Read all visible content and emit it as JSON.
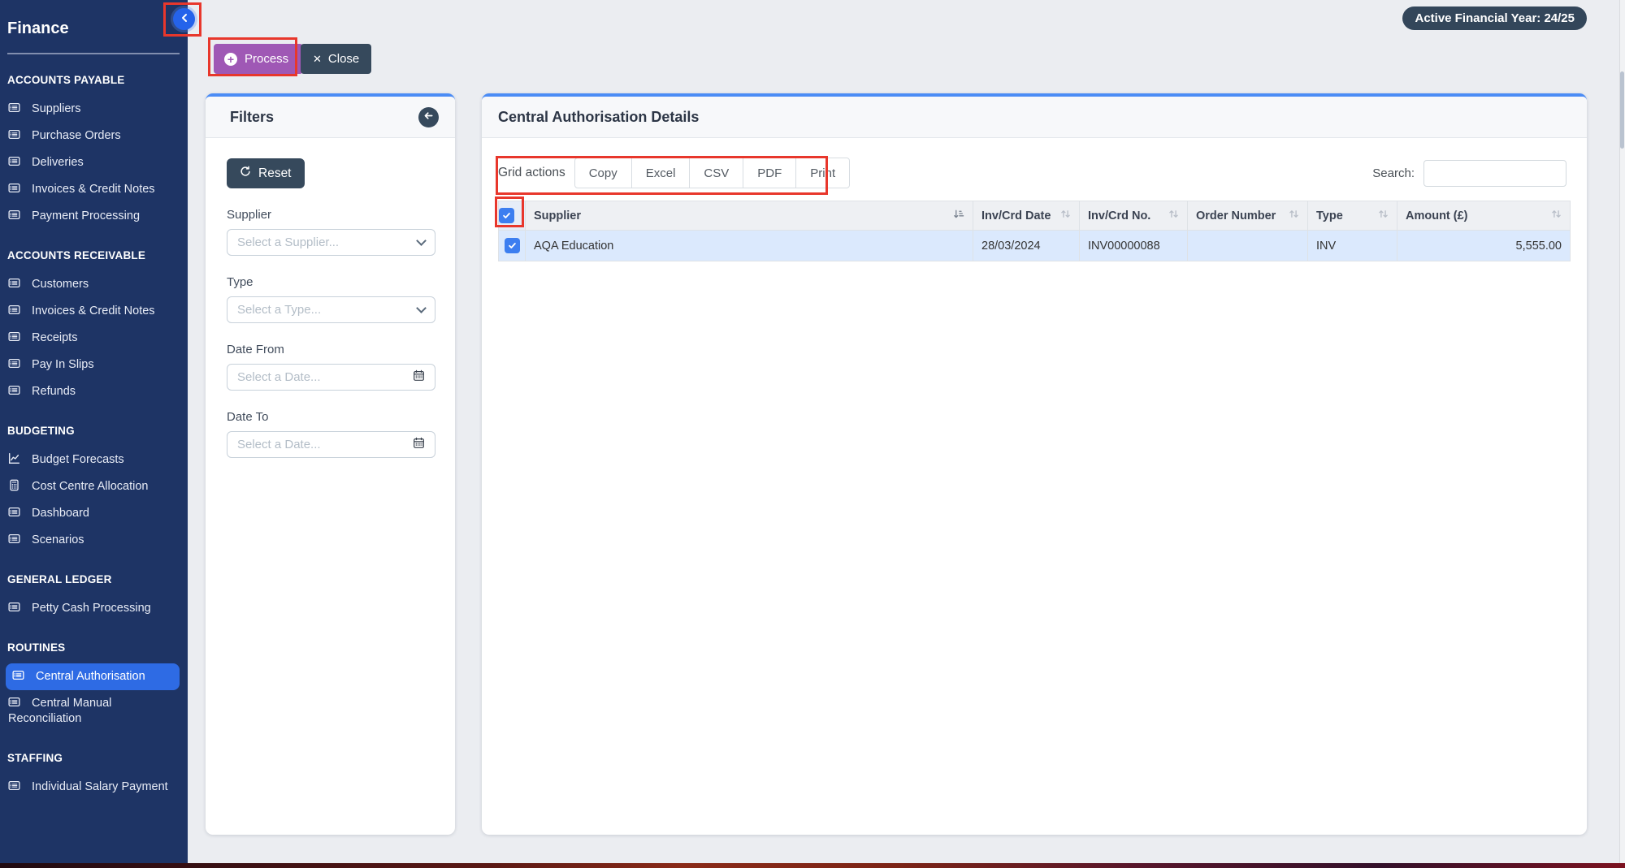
{
  "app": {
    "title": "Finance",
    "financial_year_badge": "Active Financial Year: 24/25"
  },
  "actions": {
    "process_label": "Process",
    "close_label": "Close"
  },
  "sidebar": {
    "sections": [
      {
        "title": "ACCOUNTS PAYABLE",
        "items": [
          {
            "label": "Suppliers",
            "icon": "card-list-icon"
          },
          {
            "label": "Purchase Orders",
            "icon": "card-list-icon"
          },
          {
            "label": "Deliveries",
            "icon": "card-list-icon"
          },
          {
            "label": "Invoices & Credit Notes",
            "icon": "card-list-icon"
          },
          {
            "label": "Payment Processing",
            "icon": "card-list-icon"
          }
        ]
      },
      {
        "title": "ACCOUNTS RECEIVABLE",
        "items": [
          {
            "label": "Customers",
            "icon": "card-list-icon"
          },
          {
            "label": "Invoices & Credit Notes",
            "icon": "card-list-icon"
          },
          {
            "label": "Receipts",
            "icon": "card-list-icon"
          },
          {
            "label": "Pay In Slips",
            "icon": "card-list-icon"
          },
          {
            "label": "Refunds",
            "icon": "card-list-icon"
          }
        ]
      },
      {
        "title": "BUDGETING",
        "items": [
          {
            "label": "Budget Forecasts",
            "icon": "line-chart-icon"
          },
          {
            "label": "Cost Centre Allocation",
            "icon": "calculator-icon"
          },
          {
            "label": "Dashboard",
            "icon": "card-list-icon"
          },
          {
            "label": "Scenarios",
            "icon": "card-list-icon"
          }
        ]
      },
      {
        "title": "GENERAL LEDGER",
        "items": [
          {
            "label": "Petty Cash Processing",
            "icon": "card-list-icon"
          }
        ]
      },
      {
        "title": "ROUTINES",
        "items": [
          {
            "label": "Central Authorisation",
            "icon": "card-list-icon",
            "active": true
          },
          {
            "label": "Central Manual Reconciliation",
            "icon": "card-list-icon"
          }
        ]
      },
      {
        "title": "STAFFING",
        "items": [
          {
            "label": "Individual Salary Payment",
            "icon": "card-list-icon"
          }
        ]
      }
    ]
  },
  "filters": {
    "title": "Filters",
    "reset_label": "Reset",
    "fields": [
      {
        "label": "Supplier",
        "placeholder": "Select a Supplier...",
        "control": "select"
      },
      {
        "label": "Type",
        "placeholder": "Select a Type...",
        "control": "select"
      },
      {
        "label": "Date From",
        "placeholder": "Select a Date...",
        "control": "date"
      },
      {
        "label": "Date To",
        "placeholder": "Select a Date...",
        "control": "date"
      }
    ]
  },
  "details": {
    "title": "Central Authorisation Details",
    "grid_actions_label": "Grid actions",
    "grid_buttons": [
      "Copy",
      "Excel",
      "CSV",
      "PDF",
      "Print"
    ],
    "search_label": "Search:",
    "table": {
      "columns": [
        "Supplier",
        "Inv/Crd Date",
        "Inv/Crd No.",
        "Order Number",
        "Type",
        "Amount (£)"
      ],
      "rows": [
        {
          "selected": true,
          "supplier": "AQA Education",
          "inv_crd_date": "28/03/2024",
          "inv_crd_no": "INV00000088",
          "order_number": "",
          "type": "INV",
          "amount": "5,555.00"
        }
      ]
    }
  },
  "icons": {
    "plus": "+",
    "close_x": "✕"
  },
  "colors": {
    "sidebar_bg": "#1e3465",
    "active_item_blue": "#2e6be4",
    "panel_accent_blue": "#4b8cf5",
    "process_purple": "#9f58b5",
    "slate_dark": "#36495c",
    "selected_row_blue": "#dbe9fd",
    "checkbox_blue": "#3c7ef0",
    "annotation_red": "#e8372c"
  }
}
